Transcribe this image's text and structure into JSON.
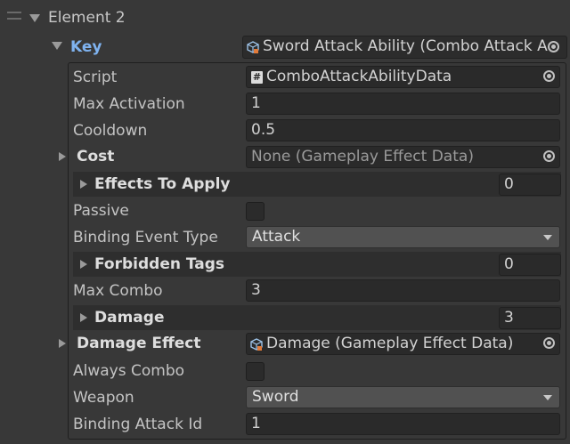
{
  "element": {
    "title": "Element 2"
  },
  "key": {
    "label": "Key",
    "value": "Sword Attack Ability (Combo Attack A"
  },
  "script": {
    "label": "Script",
    "value": "ComboAttackAbilityData"
  },
  "max_activation": {
    "label": "Max Activation",
    "value": "1"
  },
  "cooldown": {
    "label": "Cooldown",
    "value": "0.5"
  },
  "cost": {
    "label": "Cost",
    "value": "None (Gameplay Effect Data)"
  },
  "effects_to_apply": {
    "label": "Effects To Apply",
    "count": "0"
  },
  "passive": {
    "label": "Passive",
    "checked": false
  },
  "binding_event_type": {
    "label": "Binding Event Type",
    "value": "Attack"
  },
  "forbidden_tags": {
    "label": "Forbidden Tags",
    "count": "0"
  },
  "max_combo": {
    "label": "Max Combo",
    "value": "3"
  },
  "damage": {
    "label": "Damage",
    "count": "3"
  },
  "damage_effect": {
    "label": "Damage Effect",
    "value": "Damage (Gameplay Effect Data)"
  },
  "always_combo": {
    "label": "Always Combo",
    "checked": false
  },
  "weapon": {
    "label": "Weapon",
    "value": "Sword"
  },
  "binding_attack_id": {
    "label": "Binding Attack Id",
    "value": "1"
  },
  "colors": {
    "background": "#383838",
    "key_label": "#7fb3f0",
    "field_bg": "#2a2a2a",
    "dropdown_bg": "#515151",
    "section_bg": "#2e2e2e"
  },
  "icons": {
    "drag_handle": "drag-handle-icon",
    "foldout": "triangle-icon",
    "object_picker": "target-icon",
    "script": "hash-script-icon",
    "scriptable_object": "cube-icon"
  }
}
